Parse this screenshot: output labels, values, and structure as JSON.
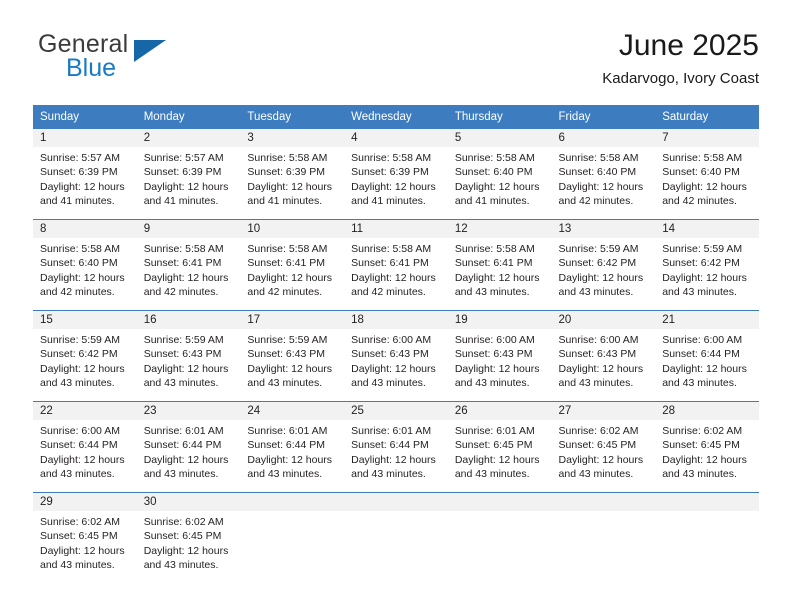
{
  "brand": {
    "name_top": "General",
    "name_bottom": "Blue",
    "triangle_color": "#1567a8",
    "blue_color": "#1a7bc4"
  },
  "header": {
    "title": "June 2025",
    "subtitle": "Kadarvogo, Ivory Coast"
  },
  "calendar": {
    "header_bg": "#3c7cbf",
    "header_text_color": "#ffffff",
    "daynum_band_bg": "#f2f2f2",
    "weekday_headers": [
      "Sunday",
      "Monday",
      "Tuesday",
      "Wednesday",
      "Thursday",
      "Friday",
      "Saturday"
    ],
    "weeks": [
      [
        {
          "day": "1",
          "sunrise": "Sunrise: 5:57 AM",
          "sunset": "Sunset: 6:39 PM",
          "daylight1": "Daylight: 12 hours",
          "daylight2": "and 41 minutes."
        },
        {
          "day": "2",
          "sunrise": "Sunrise: 5:57 AM",
          "sunset": "Sunset: 6:39 PM",
          "daylight1": "Daylight: 12 hours",
          "daylight2": "and 41 minutes."
        },
        {
          "day": "3",
          "sunrise": "Sunrise: 5:58 AM",
          "sunset": "Sunset: 6:39 PM",
          "daylight1": "Daylight: 12 hours",
          "daylight2": "and 41 minutes."
        },
        {
          "day": "4",
          "sunrise": "Sunrise: 5:58 AM",
          "sunset": "Sunset: 6:39 PM",
          "daylight1": "Daylight: 12 hours",
          "daylight2": "and 41 minutes."
        },
        {
          "day": "5",
          "sunrise": "Sunrise: 5:58 AM",
          "sunset": "Sunset: 6:40 PM",
          "daylight1": "Daylight: 12 hours",
          "daylight2": "and 41 minutes."
        },
        {
          "day": "6",
          "sunrise": "Sunrise: 5:58 AM",
          "sunset": "Sunset: 6:40 PM",
          "daylight1": "Daylight: 12 hours",
          "daylight2": "and 42 minutes."
        },
        {
          "day": "7",
          "sunrise": "Sunrise: 5:58 AM",
          "sunset": "Sunset: 6:40 PM",
          "daylight1": "Daylight: 12 hours",
          "daylight2": "and 42 minutes."
        }
      ],
      [
        {
          "day": "8",
          "sunrise": "Sunrise: 5:58 AM",
          "sunset": "Sunset: 6:40 PM",
          "daylight1": "Daylight: 12 hours",
          "daylight2": "and 42 minutes."
        },
        {
          "day": "9",
          "sunrise": "Sunrise: 5:58 AM",
          "sunset": "Sunset: 6:41 PM",
          "daylight1": "Daylight: 12 hours",
          "daylight2": "and 42 minutes."
        },
        {
          "day": "10",
          "sunrise": "Sunrise: 5:58 AM",
          "sunset": "Sunset: 6:41 PM",
          "daylight1": "Daylight: 12 hours",
          "daylight2": "and 42 minutes."
        },
        {
          "day": "11",
          "sunrise": "Sunrise: 5:58 AM",
          "sunset": "Sunset: 6:41 PM",
          "daylight1": "Daylight: 12 hours",
          "daylight2": "and 42 minutes."
        },
        {
          "day": "12",
          "sunrise": "Sunrise: 5:58 AM",
          "sunset": "Sunset: 6:41 PM",
          "daylight1": "Daylight: 12 hours",
          "daylight2": "and 43 minutes."
        },
        {
          "day": "13",
          "sunrise": "Sunrise: 5:59 AM",
          "sunset": "Sunset: 6:42 PM",
          "daylight1": "Daylight: 12 hours",
          "daylight2": "and 43 minutes."
        },
        {
          "day": "14",
          "sunrise": "Sunrise: 5:59 AM",
          "sunset": "Sunset: 6:42 PM",
          "daylight1": "Daylight: 12 hours",
          "daylight2": "and 43 minutes."
        }
      ],
      [
        {
          "day": "15",
          "sunrise": "Sunrise: 5:59 AM",
          "sunset": "Sunset: 6:42 PM",
          "daylight1": "Daylight: 12 hours",
          "daylight2": "and 43 minutes."
        },
        {
          "day": "16",
          "sunrise": "Sunrise: 5:59 AM",
          "sunset": "Sunset: 6:43 PM",
          "daylight1": "Daylight: 12 hours",
          "daylight2": "and 43 minutes."
        },
        {
          "day": "17",
          "sunrise": "Sunrise: 5:59 AM",
          "sunset": "Sunset: 6:43 PM",
          "daylight1": "Daylight: 12 hours",
          "daylight2": "and 43 minutes."
        },
        {
          "day": "18",
          "sunrise": "Sunrise: 6:00 AM",
          "sunset": "Sunset: 6:43 PM",
          "daylight1": "Daylight: 12 hours",
          "daylight2": "and 43 minutes."
        },
        {
          "day": "19",
          "sunrise": "Sunrise: 6:00 AM",
          "sunset": "Sunset: 6:43 PM",
          "daylight1": "Daylight: 12 hours",
          "daylight2": "and 43 minutes."
        },
        {
          "day": "20",
          "sunrise": "Sunrise: 6:00 AM",
          "sunset": "Sunset: 6:43 PM",
          "daylight1": "Daylight: 12 hours",
          "daylight2": "and 43 minutes."
        },
        {
          "day": "21",
          "sunrise": "Sunrise: 6:00 AM",
          "sunset": "Sunset: 6:44 PM",
          "daylight1": "Daylight: 12 hours",
          "daylight2": "and 43 minutes."
        }
      ],
      [
        {
          "day": "22",
          "sunrise": "Sunrise: 6:00 AM",
          "sunset": "Sunset: 6:44 PM",
          "daylight1": "Daylight: 12 hours",
          "daylight2": "and 43 minutes."
        },
        {
          "day": "23",
          "sunrise": "Sunrise: 6:01 AM",
          "sunset": "Sunset: 6:44 PM",
          "daylight1": "Daylight: 12 hours",
          "daylight2": "and 43 minutes."
        },
        {
          "day": "24",
          "sunrise": "Sunrise: 6:01 AM",
          "sunset": "Sunset: 6:44 PM",
          "daylight1": "Daylight: 12 hours",
          "daylight2": "and 43 minutes."
        },
        {
          "day": "25",
          "sunrise": "Sunrise: 6:01 AM",
          "sunset": "Sunset: 6:44 PM",
          "daylight1": "Daylight: 12 hours",
          "daylight2": "and 43 minutes."
        },
        {
          "day": "26",
          "sunrise": "Sunrise: 6:01 AM",
          "sunset": "Sunset: 6:45 PM",
          "daylight1": "Daylight: 12 hours",
          "daylight2": "and 43 minutes."
        },
        {
          "day": "27",
          "sunrise": "Sunrise: 6:02 AM",
          "sunset": "Sunset: 6:45 PM",
          "daylight1": "Daylight: 12 hours",
          "daylight2": "and 43 minutes."
        },
        {
          "day": "28",
          "sunrise": "Sunrise: 6:02 AM",
          "sunset": "Sunset: 6:45 PM",
          "daylight1": "Daylight: 12 hours",
          "daylight2": "and 43 minutes."
        }
      ],
      [
        {
          "day": "29",
          "sunrise": "Sunrise: 6:02 AM",
          "sunset": "Sunset: 6:45 PM",
          "daylight1": "Daylight: 12 hours",
          "daylight2": "and 43 minutes."
        },
        {
          "day": "30",
          "sunrise": "Sunrise: 6:02 AM",
          "sunset": "Sunset: 6:45 PM",
          "daylight1": "Daylight: 12 hours",
          "daylight2": "and 43 minutes."
        },
        {
          "day": "",
          "sunrise": "",
          "sunset": "",
          "daylight1": "",
          "daylight2": ""
        },
        {
          "day": "",
          "sunrise": "",
          "sunset": "",
          "daylight1": "",
          "daylight2": ""
        },
        {
          "day": "",
          "sunrise": "",
          "sunset": "",
          "daylight1": "",
          "daylight2": ""
        },
        {
          "day": "",
          "sunrise": "",
          "sunset": "",
          "daylight1": "",
          "daylight2": ""
        },
        {
          "day": "",
          "sunrise": "",
          "sunset": "",
          "daylight1": "",
          "daylight2": ""
        }
      ]
    ]
  }
}
